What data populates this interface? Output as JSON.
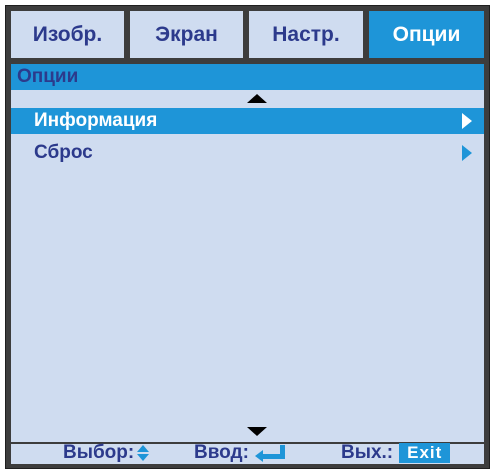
{
  "tabs": [
    {
      "label": "Изобр.",
      "active": false
    },
    {
      "label": "Экран",
      "active": false
    },
    {
      "label": "Настр.",
      "active": false
    },
    {
      "label": "Опции",
      "active": true
    }
  ],
  "section": {
    "title": "Опции"
  },
  "menu": {
    "items": [
      {
        "label": "Информация",
        "selected": true
      },
      {
        "label": "Сброс",
        "selected": false
      }
    ]
  },
  "footer": {
    "select_label": "Выбор:",
    "enter_label": "Ввод:",
    "exit_label": "Вых.:",
    "exit_key": "Exit"
  },
  "colors": {
    "accent": "#1e95d8",
    "panel": "#cfdcf0",
    "text": "#2c3a8c",
    "frame": "#3d3d3d"
  }
}
